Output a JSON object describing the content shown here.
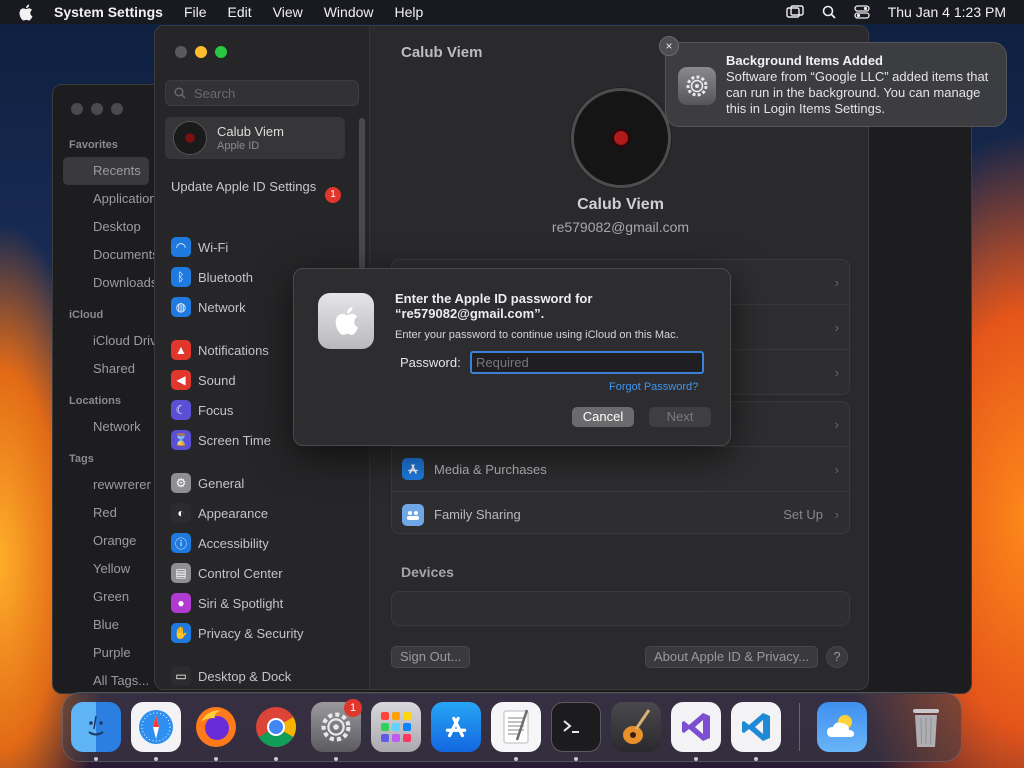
{
  "menubar": {
    "app_name": "System Settings",
    "menus": [
      "File",
      "Edit",
      "View",
      "Window",
      "Help"
    ],
    "clock": "Thu Jan 4  1:23 PM"
  },
  "finder": {
    "sections": {
      "favorites": "Favorites",
      "icloud": "iCloud",
      "locations": "Locations",
      "tags": "Tags"
    },
    "favorites": [
      "Recents",
      "Applications",
      "Desktop",
      "Documents",
      "Downloads"
    ],
    "icloud": [
      "iCloud Drive",
      "Shared"
    ],
    "locations": [
      "Network"
    ],
    "tags": [
      "rewwrerer",
      "Red",
      "Orange",
      "Yellow",
      "Green",
      "Blue",
      "Purple",
      "All Tags..."
    ]
  },
  "settings": {
    "search_placeholder": "Search",
    "account": {
      "name": "Calub Viem",
      "sub": "Apple ID"
    },
    "update": {
      "label": "Update Apple ID Settings",
      "badge": "1"
    },
    "nav": {
      "group1": [
        {
          "label": "Wi-Fi",
          "color": "#1f7ae0",
          "icon": "wifi-icon"
        },
        {
          "label": "Bluetooth",
          "color": "#1f7ae0",
          "icon": "bluetooth-icon"
        },
        {
          "label": "Network",
          "color": "#1f7ae0",
          "icon": "globe-icon"
        }
      ],
      "group2": [
        {
          "label": "Notifications",
          "color": "#e0362c",
          "icon": "bell-icon"
        },
        {
          "label": "Sound",
          "color": "#e0362c",
          "icon": "speaker-icon"
        },
        {
          "label": "Focus",
          "color": "#5b4fd6",
          "icon": "moon-icon"
        },
        {
          "label": "Screen Time",
          "color": "#5b4fd6",
          "icon": "hourglass-icon"
        }
      ],
      "group3": [
        {
          "label": "General",
          "color": "#8e8e93",
          "icon": "gear-icon"
        },
        {
          "label": "Appearance",
          "color": "#2c2c2e",
          "icon": "appearance-icon"
        },
        {
          "label": "Accessibility",
          "color": "#1f7ae0",
          "icon": "accessibility-icon"
        },
        {
          "label": "Control Center",
          "color": "#8e8e93",
          "icon": "control-center-icon"
        },
        {
          "label": "Siri & Spotlight",
          "color": "#b13bd1",
          "icon": "siri-icon"
        },
        {
          "label": "Privacy & Security",
          "color": "#1f7ae0",
          "icon": "hand-icon"
        }
      ],
      "group4": [
        {
          "label": "Desktop & Dock",
          "color": "#2c2c2e",
          "icon": "dock-icon"
        }
      ]
    },
    "main": {
      "title": "Calub Viem",
      "name": "Calub Viem",
      "email": "re579082@gmail.com",
      "media_purchases": "Media & Purchases",
      "family_sharing": "Family Sharing",
      "family_value": "Set Up",
      "devices_title": "Devices",
      "sign_out": "Sign Out...",
      "about": "About Apple ID & Privacy...",
      "help": "?"
    }
  },
  "dialog": {
    "title": "Enter the Apple ID password for “re579082@gmail.com”.",
    "message": "Enter your password to continue using iCloud on this Mac.",
    "password_label": "Password:",
    "password_placeholder": "Required",
    "forgot": "Forgot Password?",
    "cancel": "Cancel",
    "next": "Next"
  },
  "notification": {
    "title": "Background Items Added",
    "body": "Software from “Google LLC” added items that can run in the background. You can manage this in Login Items Settings."
  },
  "dock": {
    "settings_badge": "1",
    "apps": [
      "finder-icon",
      "safari-icon",
      "firefox-icon",
      "chrome-icon",
      "system-settings-icon",
      "launchpad-icon",
      "app-store-icon",
      "textedit-icon",
      "terminal-icon",
      "garageband-icon",
      "visual-studio-icon",
      "vscode-icon",
      "weather-icon",
      "trash-icon"
    ]
  }
}
